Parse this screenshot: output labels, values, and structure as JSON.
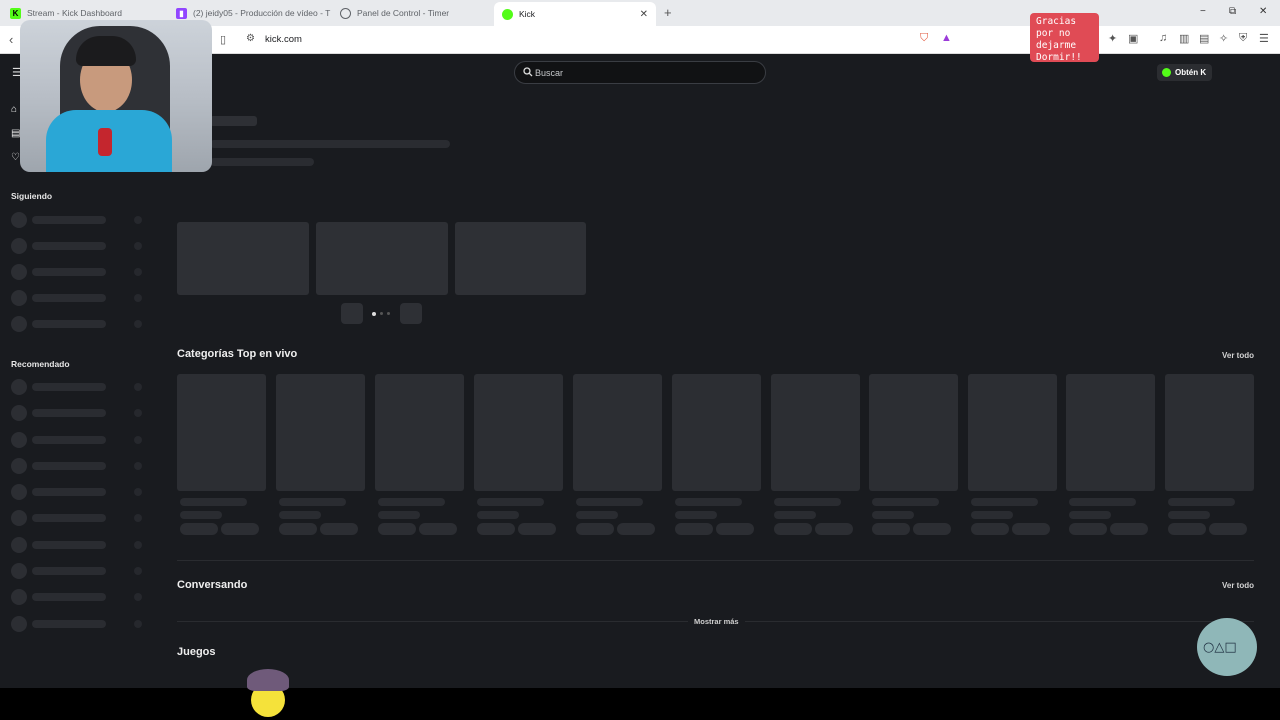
{
  "browser": {
    "tabs": [
      {
        "title": "Stream - Kick Dashboard",
        "icon": "kick-icon",
        "color": "#53fc18"
      },
      {
        "title": "(2) jeidy05 - Producción de vídeo - T",
        "icon": "twitch-icon",
        "color": "#9146ff"
      },
      {
        "title": "Panel de Control - Timer",
        "icon": "globe-icon",
        "color": "#5f6368"
      },
      {
        "title": "Kick",
        "icon": "kick-icon",
        "color": "#53fc18"
      }
    ],
    "new_tab": "+",
    "window_controls": [
      "−",
      "⧉",
      "✕"
    ],
    "url": "kick.com"
  },
  "page": {
    "search_placeholder": "Buscar",
    "sidebar": {
      "following_label": "Siguiendo",
      "recommended_label": "Recomendado"
    },
    "sections": {
      "top_categories": {
        "title": "Categorías Top en vivo",
        "see_all": "Ver todo"
      },
      "chatting": {
        "title": "Conversando",
        "see_all": "Ver todo",
        "show_more": "Mostrar más"
      },
      "games": {
        "title": "Juegos"
      }
    },
    "cta_label": "Obtén K"
  },
  "overlay": {
    "sticker_text": "Gracias\npor no\ndejarme\nDormir!!"
  },
  "colors": {
    "page_bg": "#191b1f",
    "kick_green": "#53fc18",
    "sticker_red": "#e04b55"
  }
}
